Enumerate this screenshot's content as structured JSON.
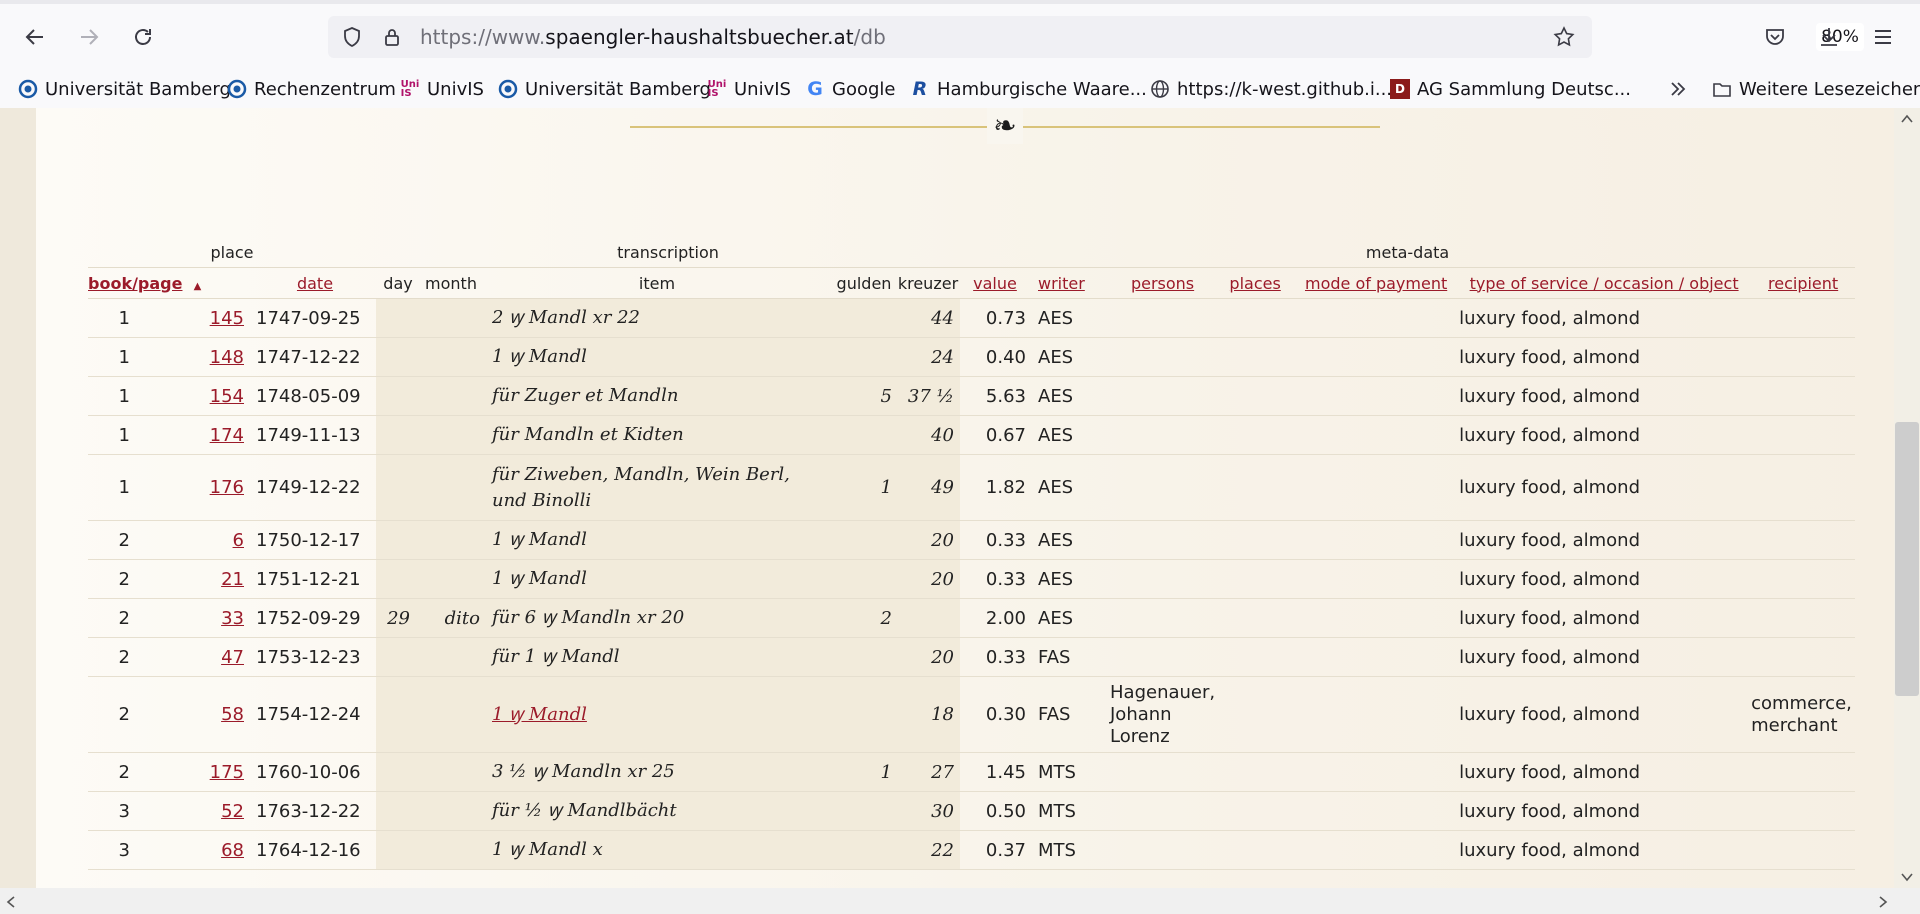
{
  "browser": {
    "url_prefix": "https://www.",
    "url_domain": "spaengler-haushaltsbuecher.at",
    "url_path": "/db",
    "zoom": "80%"
  },
  "bookmarks": [
    {
      "label": "Universität Bamberg",
      "icon": "bamberg-icon"
    },
    {
      "label": "Rechenzentrum",
      "icon": "bamberg-icon"
    },
    {
      "label": "UnivIS",
      "icon": "univis-icon"
    },
    {
      "label": "Universität Bamberg",
      "icon": "bamberg-icon"
    },
    {
      "label": "UnivIS",
      "icon": "univis-icon"
    },
    {
      "label": "Google",
      "icon": "google-icon"
    },
    {
      "label": "Hamburgische Waare...",
      "icon": "r-icon"
    },
    {
      "label": "https://k-west.github.i...",
      "icon": "globe-icon"
    },
    {
      "label": "AG Sammlung Deutsc...",
      "icon": "ag-icon"
    },
    {
      "label": "Weitere Lesezeichen",
      "icon": "folder-icon"
    }
  ],
  "page": {
    "ornament": "❧"
  },
  "table": {
    "groups": {
      "place": "place",
      "transcription": "transcription",
      "meta": "meta-data"
    },
    "headers": {
      "book_page": "book/page",
      "sort_arrow": "▲",
      "date": "date",
      "day": "day",
      "month": "month",
      "item": "item",
      "gulden": "gulden",
      "kreuzer": "kreuzer",
      "value": "value",
      "writer": "writer",
      "persons": "persons",
      "places": "places",
      "mode": "mode of payment",
      "type": "type of service / occasion / object",
      "recipient": "recipient"
    },
    "rows": [
      {
        "book": "1",
        "page": "145",
        "date": "1747-09-25",
        "day": "",
        "month": "",
        "item": "2 ꝡ Mandl xr 22",
        "gulden": "",
        "kreuzer": "44",
        "value": "0.73",
        "writer": "AES",
        "persons": "",
        "type": "luxury food, almond",
        "recipient": ""
      },
      {
        "book": "1",
        "page": "148",
        "date": "1747-12-22",
        "day": "",
        "month": "",
        "item": "1 ꝡ Mandl",
        "gulden": "",
        "kreuzer": "24",
        "value": "0.40",
        "writer": "AES",
        "persons": "",
        "type": "luxury food, almond",
        "recipient": ""
      },
      {
        "book": "1",
        "page": "154",
        "date": "1748-05-09",
        "day": "",
        "month": "",
        "item": "für Zuger et Mandln",
        "gulden": "5",
        "kreuzer": "37 ½",
        "value": "5.63",
        "writer": "AES",
        "persons": "",
        "type": "luxury food, almond",
        "recipient": ""
      },
      {
        "book": "1",
        "page": "174",
        "date": "1749-11-13",
        "day": "",
        "month": "",
        "item": "für Mandln et Kidten",
        "gulden": "",
        "kreuzer": "40",
        "value": "0.67",
        "writer": "AES",
        "persons": "",
        "type": "luxury food, almond",
        "recipient": ""
      },
      {
        "book": "1",
        "page": "176",
        "date": "1749-12-22",
        "day": "",
        "month": "",
        "item": "für Ziweben, Mandln, Wein Berl, und Binolli",
        "gulden": "1",
        "kreuzer": "49",
        "value": "1.82",
        "writer": "AES",
        "persons": "",
        "type": "luxury food, almond",
        "recipient": ""
      },
      {
        "book": "2",
        "page": "6",
        "date": "1750-12-17",
        "day": "",
        "month": "",
        "item": "1 ꝡ Mandl",
        "gulden": "",
        "kreuzer": "20",
        "value": "0.33",
        "writer": "AES",
        "persons": "",
        "type": "luxury food, almond",
        "recipient": ""
      },
      {
        "book": "2",
        "page": "21",
        "date": "1751-12-21",
        "day": "",
        "month": "",
        "item": "1 ꝡ Mandl",
        "gulden": "",
        "kreuzer": "20",
        "value": "0.33",
        "writer": "AES",
        "persons": "",
        "type": "luxury food, almond",
        "recipient": ""
      },
      {
        "book": "2",
        "page": "33",
        "date": "1752-09-29",
        "day": "29",
        "month": "dito",
        "item": "für 6 ꝡ Mandln xr 20",
        "gulden": "2",
        "kreuzer": "",
        "value": "2.00",
        "writer": "AES",
        "persons": "",
        "type": "luxury food, almond",
        "recipient": ""
      },
      {
        "book": "2",
        "page": "47",
        "date": "1753-12-23",
        "day": "",
        "month": "",
        "item": "für 1 ꝡ Mandl",
        "gulden": "",
        "kreuzer": "20",
        "value": "0.33",
        "writer": "FAS",
        "persons": "",
        "type": "luxury food, almond",
        "recipient": ""
      },
      {
        "book": "2",
        "page": "58",
        "date": "1754-12-24",
        "day": "",
        "month": "",
        "item": "1 ꝡ Mandl",
        "gulden": "",
        "kreuzer": "18",
        "value": "0.30",
        "writer": "FAS",
        "persons": "Hagenauer, Johann Lorenz",
        "type": "luxury food, almond",
        "recipient": "commerce, merchant",
        "item_link": true
      },
      {
        "book": "2",
        "page": "175",
        "date": "1760-10-06",
        "day": "",
        "month": "",
        "item": "3 ½ ꝡ Mandln xr 25",
        "gulden": "1",
        "kreuzer": "27",
        "value": "1.45",
        "writer": "MTS",
        "persons": "",
        "type": "luxury food, almond",
        "recipient": ""
      },
      {
        "book": "3",
        "page": "52",
        "date": "1763-12-22",
        "day": "",
        "month": "",
        "item": "für ½ ꝡ Mandlbächt",
        "gulden": "",
        "kreuzer": "30",
        "value": "0.50",
        "writer": "MTS",
        "persons": "",
        "type": "luxury food, almond",
        "recipient": ""
      },
      {
        "book": "3",
        "page": "68",
        "date": "1764-12-16",
        "day": "",
        "month": "",
        "item": "1 ꝡ Mandl x",
        "gulden": "",
        "kreuzer": "22",
        "value": "0.37",
        "writer": "MTS",
        "persons": "",
        "type": "luxury food, almond",
        "recipient": ""
      }
    ]
  }
}
